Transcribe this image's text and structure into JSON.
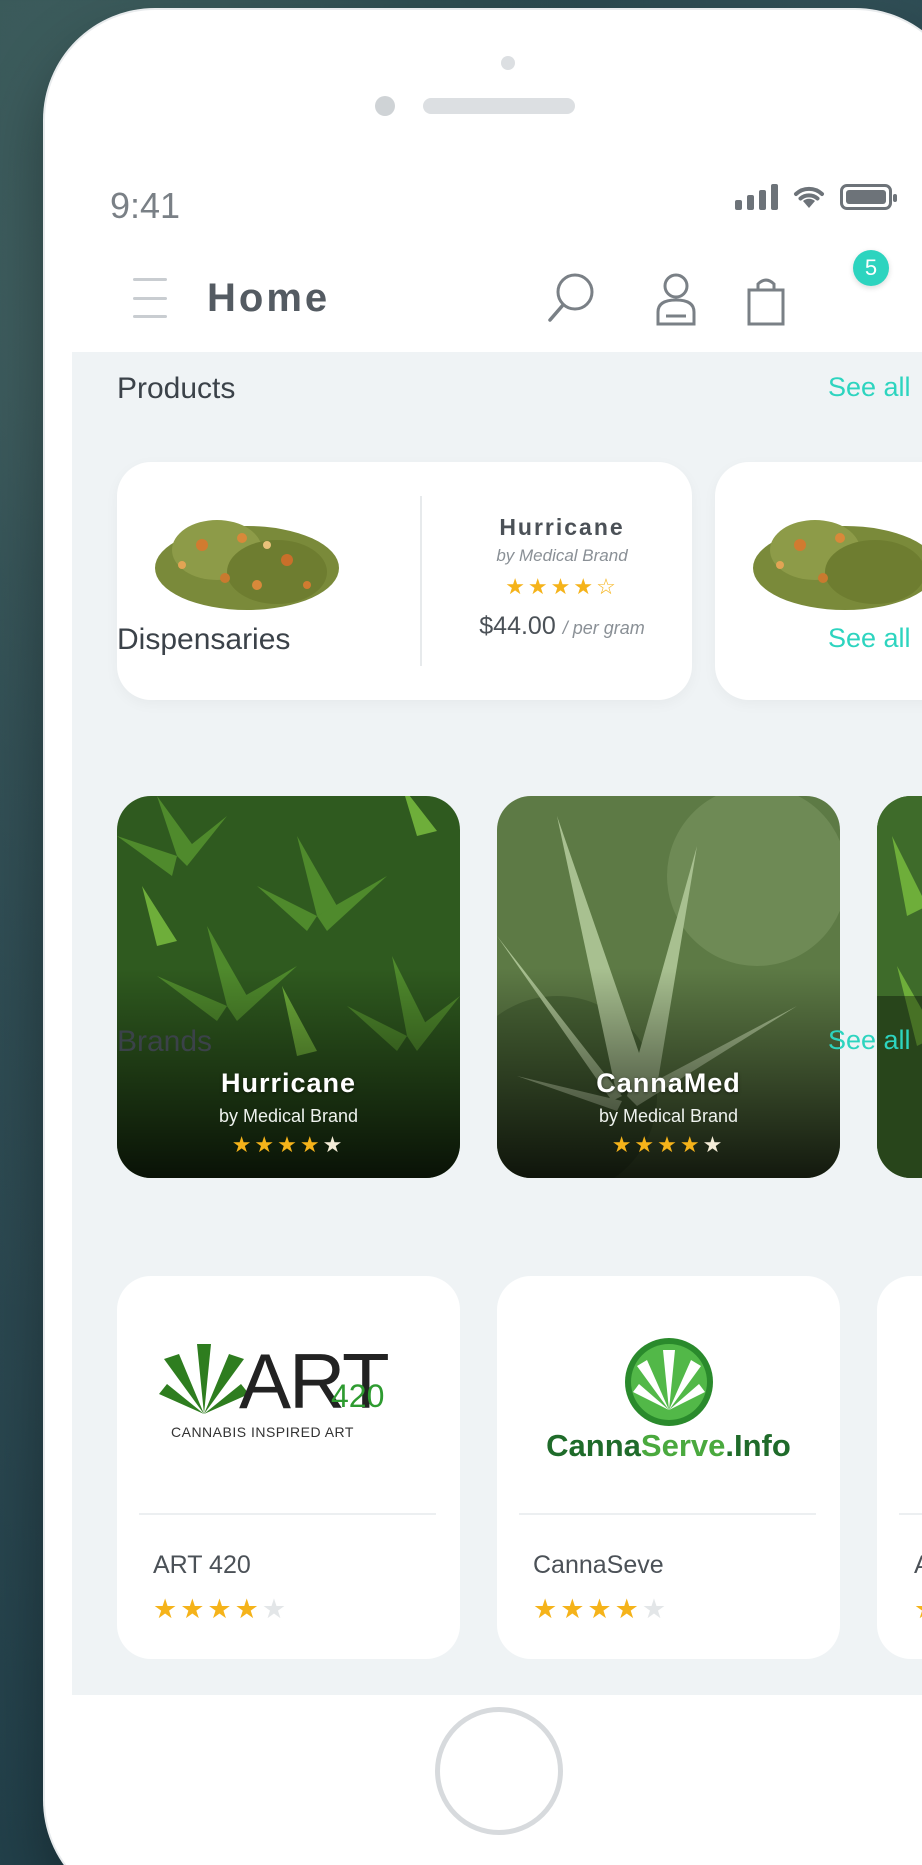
{
  "status_bar": {
    "time": "9:41"
  },
  "header": {
    "title": "Home",
    "cart_count": "5"
  },
  "sections": {
    "products": {
      "title": "Products",
      "see_all": "See all"
    },
    "dispensaries": {
      "title": "Dispensaries",
      "see_all": "See all"
    },
    "brands": {
      "title": "Brands",
      "see_all": "See all"
    }
  },
  "products": [
    {
      "name": "Hurricane",
      "brand": "by Medical Brand",
      "rating": 4,
      "price": "$44.00",
      "unit": "/ per gram"
    }
  ],
  "dispensaries": [
    {
      "name": "Hurricane",
      "brand": "by Medical Brand",
      "rating": 4.5
    },
    {
      "name": "CannaMed",
      "brand": "by Medical Brand",
      "rating": 4.5
    }
  ],
  "brands": [
    {
      "name": "ART 420",
      "logo_main": "ART",
      "logo_num": "420",
      "logo_sub": "CANNABIS INSPIRED ART",
      "rating": 4.5
    },
    {
      "name": "CannaSeve",
      "logo_a": "Canna",
      "logo_b": "Serve",
      "logo_c": ".Info",
      "rating": 4.5
    },
    {
      "name": "A"
    }
  ],
  "colors": {
    "accent": "#2dd4bf",
    "star": "#f5b31a",
    "background": "#eff3f5"
  }
}
